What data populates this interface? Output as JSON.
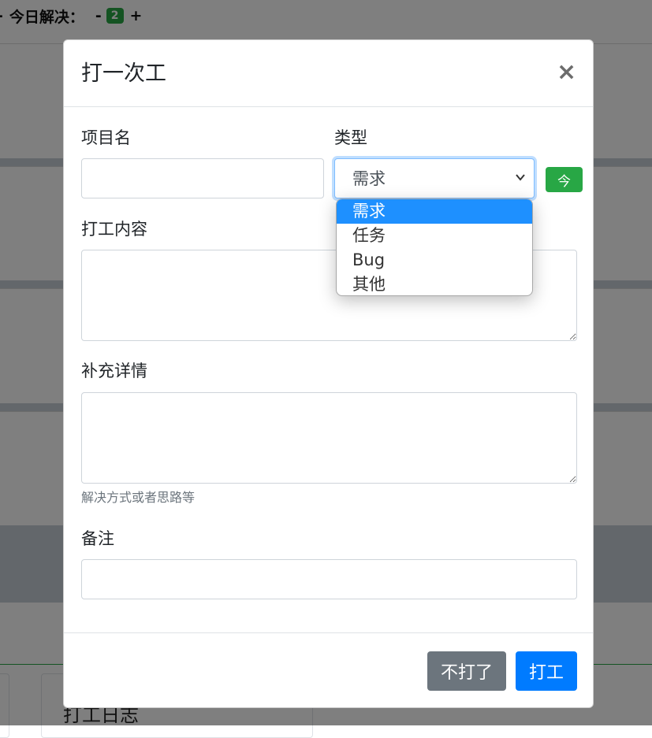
{
  "background": {
    "header": {
      "dash": "-",
      "label": "今日解决：",
      "minus": "-",
      "count": "2",
      "plus": "+"
    },
    "log_title": "打工日志"
  },
  "modal": {
    "title": "打一次工",
    "close_label": "×",
    "fields": {
      "project_name": {
        "label": "项目名",
        "value": ""
      },
      "type": {
        "label": "类型",
        "selected": "需求",
        "options": [
          "需求",
          "任务",
          "Bug",
          "其他"
        ],
        "dropdown_open": true
      },
      "today_button": "今",
      "content": {
        "label": "打工内容",
        "value": ""
      },
      "details": {
        "label": "补充详情",
        "value": "",
        "help": "解决方式或者思路等"
      },
      "remark": {
        "label": "备注",
        "value": ""
      }
    },
    "footer": {
      "cancel_label": "不打了",
      "submit_label": "打工"
    }
  },
  "colors": {
    "primary": "#007bff",
    "secondary": "#6c757d",
    "success": "#28a745",
    "option_highlight": "#1e90ff"
  }
}
